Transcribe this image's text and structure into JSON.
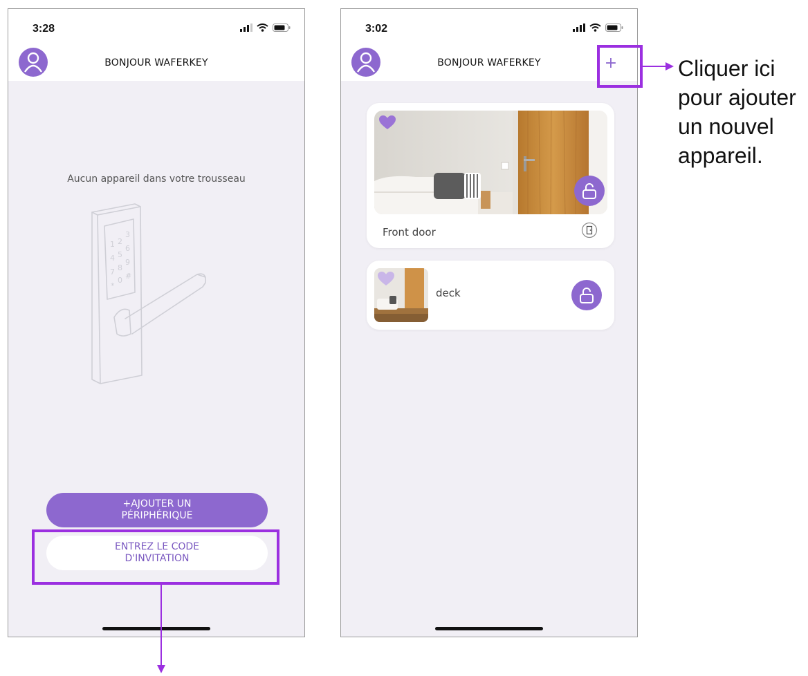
{
  "left_screen": {
    "status_time": "3:28",
    "header_title": "BONJOUR WAFERKEY",
    "empty_message": "Aucun appareil dans votre trousseau",
    "keypad_digits": [
      "1",
      "2",
      "3",
      "4",
      "5",
      "6",
      "7",
      "8",
      "9",
      "*",
      "0",
      "#"
    ],
    "add_device_button": {
      "line1": "+AJOUTER UN",
      "line2": "PÉRIPHÉRIQUE"
    },
    "invite_code_button": {
      "line1": "ENTREZ LE CODE",
      "line2": "D'INVITATION"
    }
  },
  "right_screen": {
    "status_time": "3:02",
    "header_title": "BONJOUR WAFERKEY",
    "add_icon": "+",
    "devices": [
      {
        "name": "Front door",
        "favorite": true,
        "lock_state": "unlocked"
      },
      {
        "name": "deck",
        "favorite": false,
        "lock_state": "unlocked"
      }
    ]
  },
  "annotation": {
    "lines": [
      "Cliquer ici",
      "pour ajouter",
      "un nouvel",
      "appareil."
    ]
  },
  "colors": {
    "accent": "#8d68cf",
    "highlight": "#9b2fe0",
    "background": "#f1eff5",
    "heart_light": "#c9b6e8"
  },
  "icons": {
    "avatar": "user-avatar-icon",
    "signal": "cellular-signal-icon",
    "wifi": "wifi-icon",
    "battery": "battery-icon",
    "lock": "unlocked-padlock-icon",
    "heart": "heart-icon",
    "door": "door-icon",
    "arrow": "arrow-icon"
  }
}
